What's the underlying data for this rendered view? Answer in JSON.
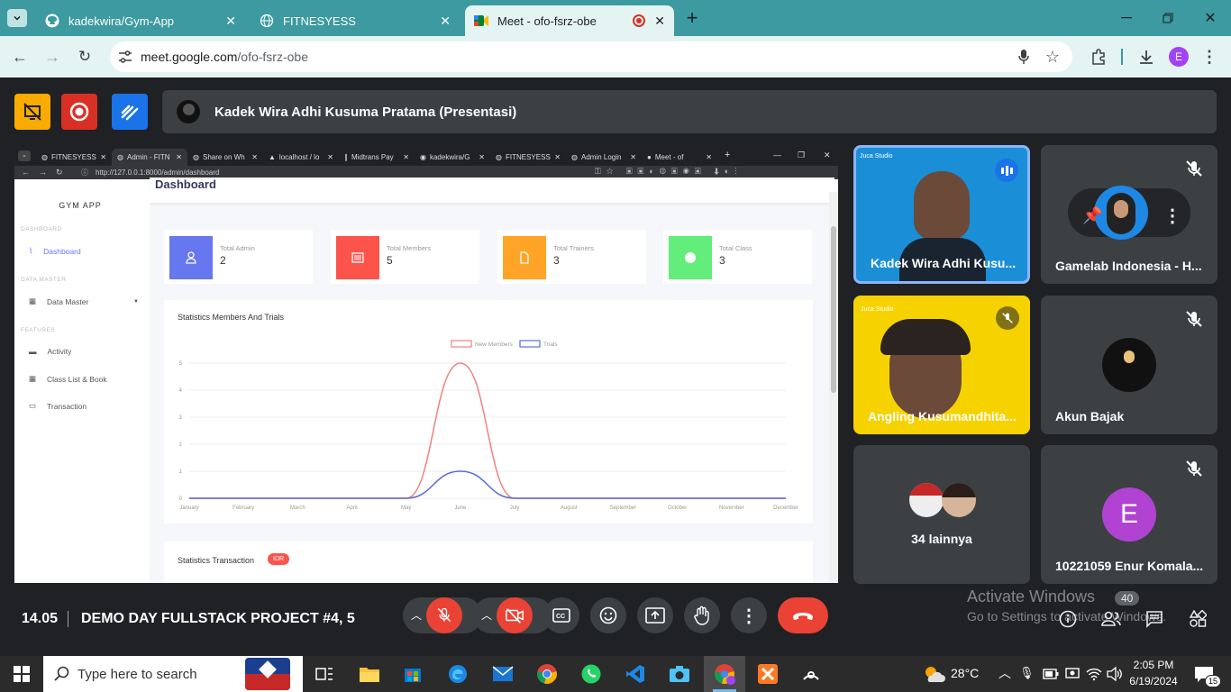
{
  "browser": {
    "tabs": [
      {
        "title": "kadekwira/Gym-App",
        "icon": "github-icon"
      },
      {
        "title": "FITNESYESS",
        "icon": "globe-icon"
      },
      {
        "title": "Meet - ofo-fsrz-obe",
        "icon": "meet-icon"
      }
    ],
    "url_host": "meet.google.com",
    "url_path": "/ofo-fsrz-obe",
    "profile_initial": "E",
    "colors": {
      "frame": "#3c9aa0",
      "toolbar": "#e4f4f3"
    }
  },
  "meet": {
    "presenter_label": "Kadek Wira Adhi Kusuma Pratama (Presentasi)",
    "time": "14.05",
    "meeting_title": "DEMO DAY FULLSTACK PROJECT #4, 5",
    "participants": [
      {
        "name": "Kadek Wira Adhi Kusu...",
        "brand_text": "Juca Studio"
      },
      {
        "name": "Gamelab Indonesia - H..."
      },
      {
        "name": "Angling Kusumandhita...",
        "brand_text": "Juca Studio"
      },
      {
        "name": "Akun Bajak"
      },
      {
        "name": "34 lainnya"
      },
      {
        "name": "10221059 Enur Komala...",
        "initial": "E"
      }
    ],
    "watermark": {
      "line1": "Activate Windows",
      "line2": "Go to Settings to activate Windows.",
      "badge": "40"
    }
  },
  "shared": {
    "tabs": [
      "FITNESYESS",
      "Admin - FITN",
      "Share on Wh",
      "localhost / lo",
      "Midtrans Pay",
      "kadekwira/G",
      "FITNESYESS",
      "Admin Login",
      "Meet - of"
    ],
    "url": "http://127.0.0.1:8000/admin/dashboard",
    "page_title": "Dashboard",
    "brand": "GYM APP",
    "sidebar": {
      "sec_dashboard": "DASHBOARD",
      "dashboard": "Dashboard",
      "sec_master": "DATA MASTER",
      "data_master": "Data Master",
      "sec_features": "FEATURES",
      "activity": "Activity",
      "class_list": "Class List & Book",
      "transaction": "Transaction"
    },
    "cards": [
      {
        "label": "Total Admin",
        "value": "2",
        "color": "#6777ef"
      },
      {
        "label": "Total Members",
        "value": "5",
        "color": "#fc544b"
      },
      {
        "label": "Total Trainers",
        "value": "3",
        "color": "#ffa426"
      },
      {
        "label": "Total Class",
        "value": "3",
        "color": "#63ed7a"
      }
    ],
    "stats_title": "Statistics Members And Trials",
    "trans_title": "Statistics Transaction",
    "trans_badge": "IDR"
  },
  "chart_data": {
    "type": "line",
    "categories": [
      "January",
      "February",
      "March",
      "April",
      "May",
      "June",
      "July",
      "August",
      "September",
      "October",
      "November",
      "December"
    ],
    "series": [
      {
        "name": "New Members",
        "values": [
          0,
          0,
          0,
          0,
          0,
          5,
          0,
          0,
          0,
          0,
          0,
          0
        ],
        "color": "#f08080"
      },
      {
        "name": "Trials",
        "values": [
          0,
          0,
          0,
          0,
          0,
          1,
          0,
          0,
          0,
          0,
          0,
          0
        ],
        "color": "#5b6bd6"
      }
    ],
    "yticks": [
      "0",
      "1",
      "2",
      "3",
      "4",
      "5"
    ],
    "ylim": [
      0,
      5
    ],
    "legend": "top-center",
    "grid": true
  },
  "taskbar": {
    "search_placeholder": "Type here to search",
    "weather": "28°C",
    "time": "2:05 PM",
    "date": "6/19/2024",
    "notifications": "15"
  }
}
